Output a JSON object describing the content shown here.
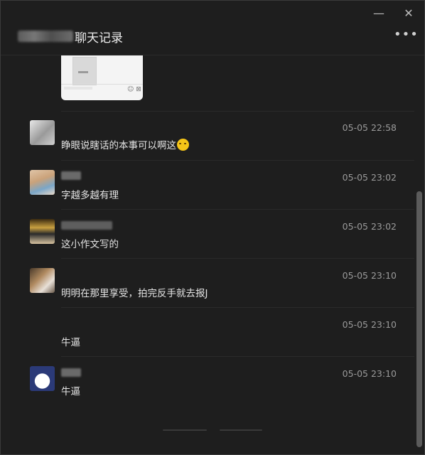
{
  "window": {
    "minimize_label": "—",
    "close_label": "✕",
    "title_suffix": "聊天记录",
    "more_label": "•••"
  },
  "messages": [
    {
      "time": "05-05 22:58",
      "text": "睁眼说瞎话的本事可以啊这",
      "emoji": "cat-grin-emoji"
    },
    {
      "time": "05-05 23:02",
      "text": "字越多越有理"
    },
    {
      "time": "05-05 23:02",
      "text": "这小作文写的"
    },
    {
      "time": "05-05 23:10",
      "text": "明明在那里享受，拍完反手就去报J"
    },
    {
      "time": "05-05 23:10",
      "text": "牛逼"
    },
    {
      "time": "05-05 23:10",
      "text": "牛逼"
    }
  ]
}
